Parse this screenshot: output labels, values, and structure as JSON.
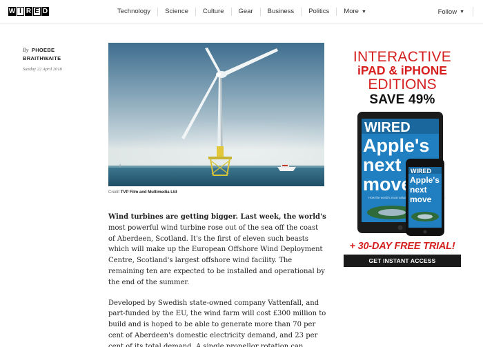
{
  "header": {
    "logo": [
      "W",
      "I",
      "R",
      "E",
      "D"
    ],
    "nav": [
      "Technology",
      "Science",
      "Culture",
      "Gear",
      "Business",
      "Politics"
    ],
    "more_label": "More",
    "follow_label": "Follow"
  },
  "byline": {
    "by": "By",
    "author_line1": "PHOEBE",
    "author_line2": "BRAITHWAITE",
    "date": "Sunday 22 April 2018"
  },
  "hero": {
    "credit_prefix": "Credit",
    "credit_name": "TVP Film and Multimedia Ltd"
  },
  "article": {
    "lead": "Wind turbines are getting bigger. Last week, the world's",
    "p1_rest": " most powerful wind turbine rose out of the sea off the coast of Aberdeen, Scotland. It's the first of eleven such beasts which will make up the European Offshore Wind Deployment Centre, Scotland's largest offshore wind facility. The remaining ten are expected to be installed and operational by the end of the summer.",
    "p2": "Developed by Swedish state-owned company Vattenfall, and part-funded by the EU, the wind farm will cost £300 million to build and is hoped to be able to generate more than 70 per cent of Aberdeen's domestic electricity demand, and 23 per cent of its total demand. A single propellor rotation can"
  },
  "ad": {
    "line1": "INTERACTIVE",
    "line2": "iPAD & iPHONE",
    "line3": "EDITIONS",
    "line4": "SAVE 49%",
    "tablet_masthead": "WIRED",
    "tablet_headline_1": "Apple's",
    "tablet_headline_2": "next",
    "tablet_headline_3": "move",
    "tablet_sub": "How the world's most valuable company can stay on top",
    "phone_masthead": "WIRED",
    "phone_headline_1": "Apple's",
    "phone_headline_2": "next",
    "phone_headline_3": "move",
    "trial": "+ 30-DAY FREE TRIAL!",
    "cta": "GET INSTANT ACCESS"
  },
  "colors": {
    "ad_red": "#d62020",
    "magazine_blue": "#1f7fc0"
  }
}
